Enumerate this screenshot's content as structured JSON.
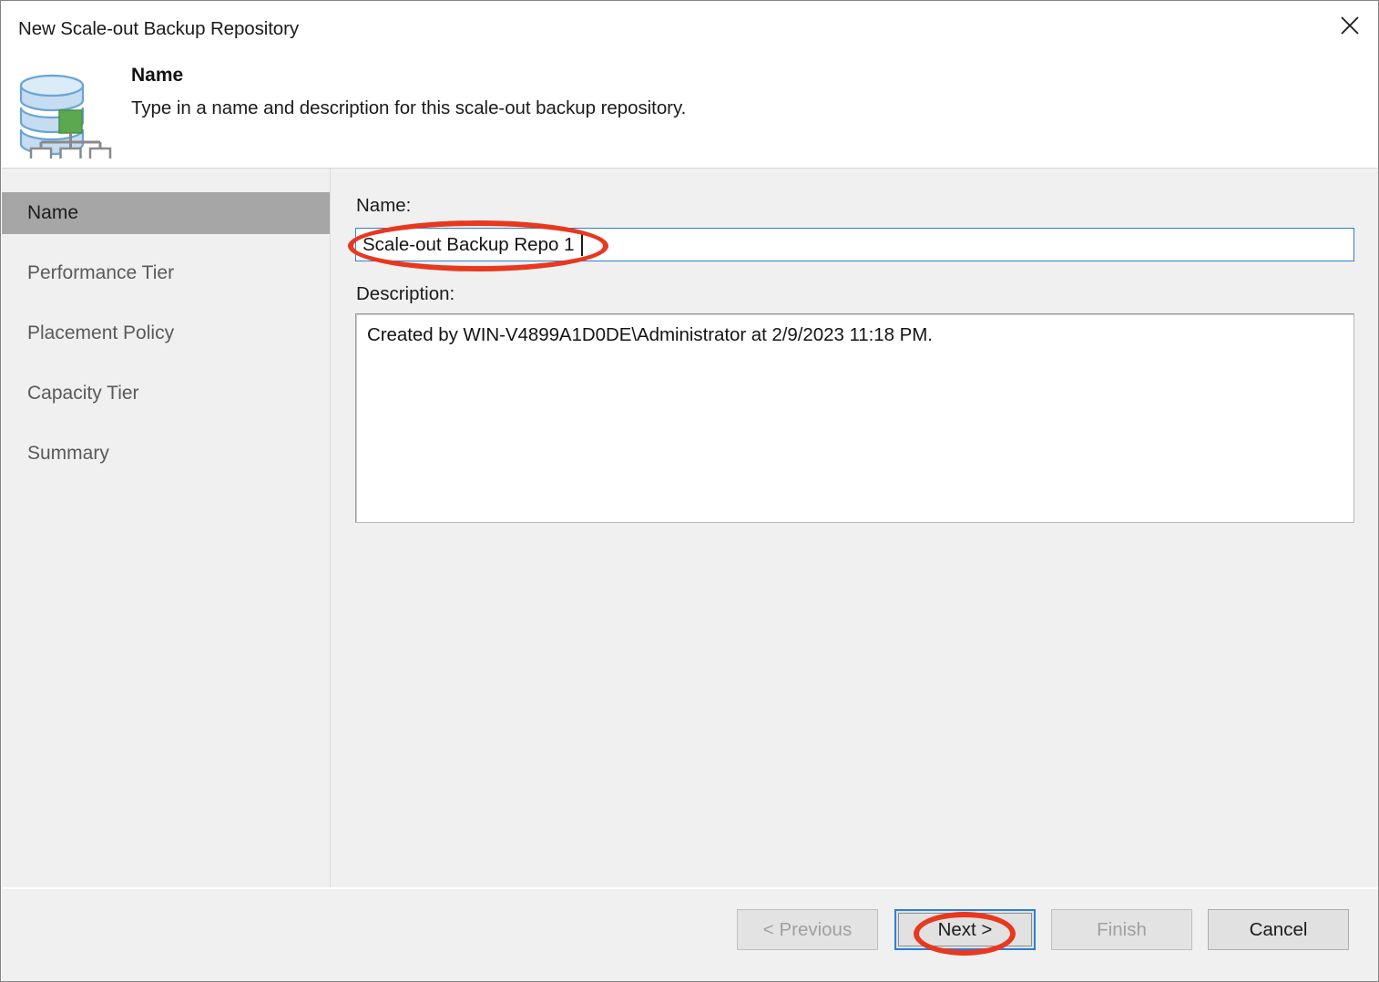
{
  "window": {
    "title": "New Scale-out Backup Repository",
    "close_icon": "close-icon"
  },
  "header": {
    "icon": "scale-out-backup-repository-icon",
    "title": "Name",
    "subtitle": "Type in a name and description for this scale-out backup repository."
  },
  "sidebar": {
    "items": [
      {
        "label": "Name",
        "active": true
      },
      {
        "label": "Performance Tier",
        "active": false
      },
      {
        "label": "Placement Policy",
        "active": false
      },
      {
        "label": "Capacity Tier",
        "active": false
      },
      {
        "label": "Summary",
        "active": false
      }
    ]
  },
  "main": {
    "name_label": "Name:",
    "name_value": "Scale-out Backup Repo 1",
    "name_placeholder": "",
    "description_label": "Description:",
    "description_value": "Created by WIN-V4899A1D0DE\\Administrator at 2/9/2023 11:18 PM."
  },
  "footer": {
    "previous_label": "< Previous",
    "next_label": "Next >",
    "finish_label": "Finish",
    "cancel_label": "Cancel"
  },
  "colors": {
    "annotation": "#e8381f",
    "focus_blue": "#2b7fd4",
    "sidebar_active": "#a6a6a6",
    "dialog_bg": "#f0f0f0",
    "icon_green": "#5aa84f",
    "icon_blue": "#bcd7ef"
  }
}
